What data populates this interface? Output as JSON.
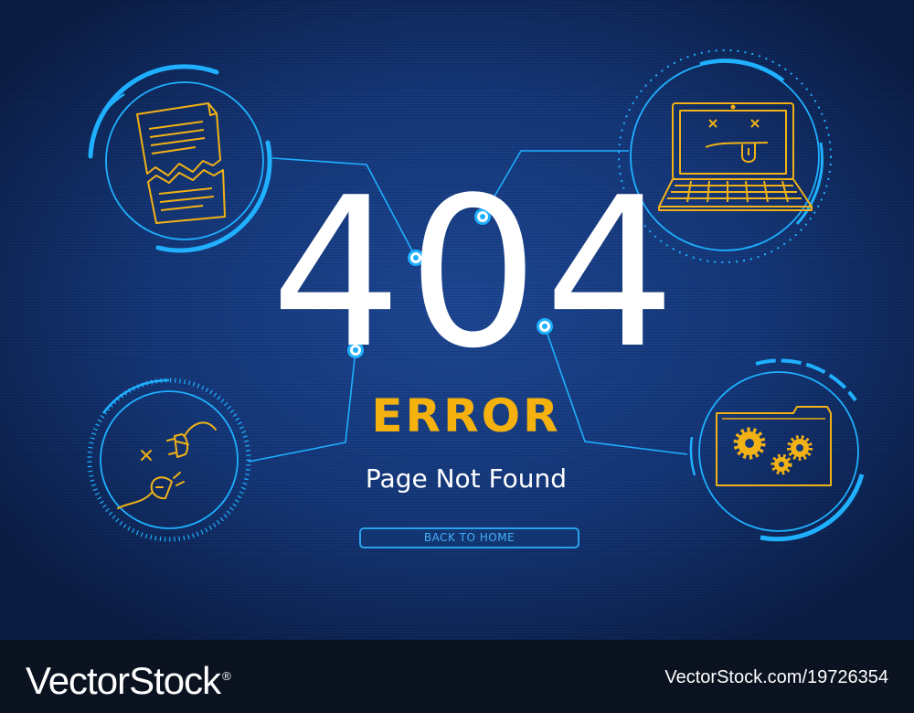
{
  "error_page": {
    "code": "404",
    "heading": "ERROR",
    "message": "Page Not Found",
    "back_button_label": "BACK TO HOME"
  },
  "icons": [
    "torn-document-icon",
    "broken-laptop-icon",
    "unplugged-cable-icon",
    "folder-gears-icon"
  ],
  "colors": {
    "background": "#16397a",
    "accent_cyan": "#1fb0ff",
    "line_yellow": "#f2b215",
    "heading_yellow": "#f5b20f",
    "text_white": "#ffffff"
  },
  "watermark": {
    "brand": "VectorStock",
    "registered_mark": "®",
    "url": "VectorStock.com/19726354"
  }
}
